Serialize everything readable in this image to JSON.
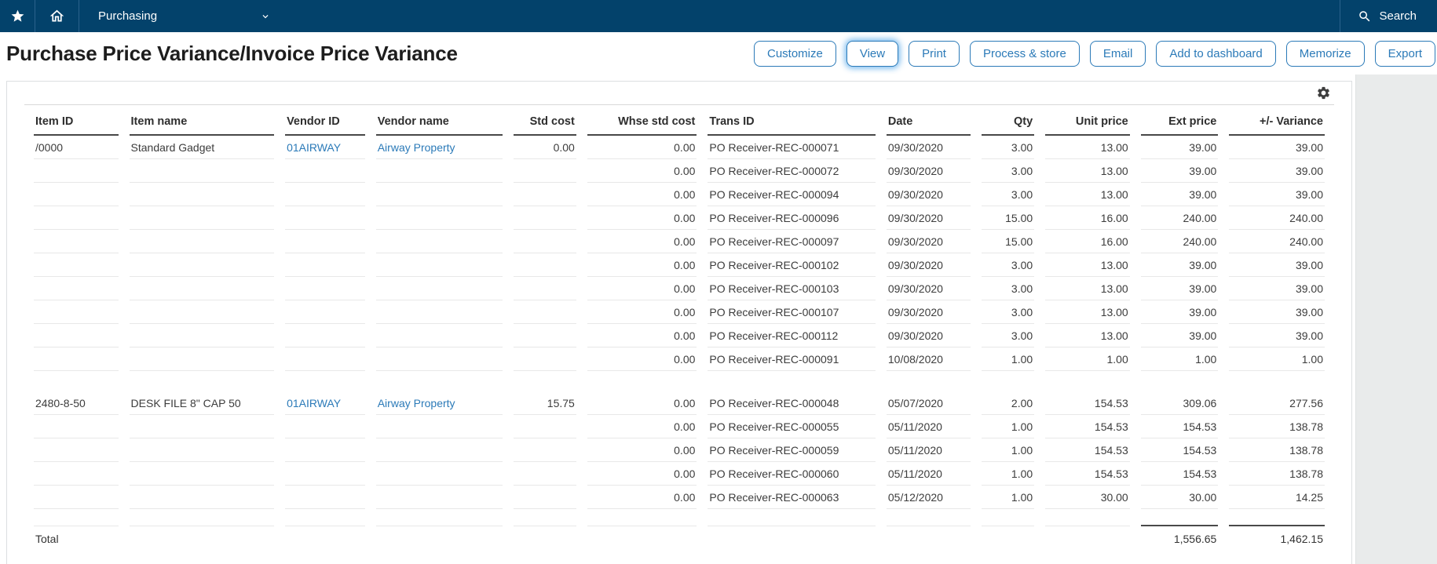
{
  "nav": {
    "menu_label": "Purchasing",
    "search_label": "Search",
    "icons": [
      "star-icon",
      "home-icon",
      "chevron-down-icon",
      "magnifier-icon"
    ]
  },
  "page": {
    "title": "Purchase Price Variance/Invoice Price Variance"
  },
  "toolbar": {
    "buttons": [
      {
        "label": "Customize"
      },
      {
        "label": "View",
        "focused": true
      },
      {
        "label": "Print"
      },
      {
        "label": "Process & store"
      },
      {
        "label": "Email"
      },
      {
        "label": "Add to dashboard"
      },
      {
        "label": "Memorize"
      },
      {
        "label": "Export"
      }
    ]
  },
  "card": {
    "settings_icon": "gear-icon"
  },
  "report": {
    "columns": [
      {
        "label": "Item ID",
        "align": "left"
      },
      {
        "label": "Item name",
        "align": "left"
      },
      {
        "label": "Vendor ID",
        "align": "left"
      },
      {
        "label": "Vendor name",
        "align": "left"
      },
      {
        "label": "Std cost",
        "align": "right"
      },
      {
        "label": "Whse std cost",
        "align": "right"
      },
      {
        "label": "Trans ID",
        "align": "left"
      },
      {
        "label": "Date",
        "align": "left"
      },
      {
        "label": "Qty",
        "align": "right"
      },
      {
        "label": "Unit price",
        "align": "right"
      },
      {
        "label": "Ext price",
        "align": "right"
      },
      {
        "label": "+/- Variance",
        "align": "right"
      }
    ],
    "groups": [
      {
        "item_id": "/0000",
        "item_name": "Standard Gadget",
        "vendor_id": "01AIRWAY",
        "vendor_name": "Airway Property",
        "std_cost": "0.00",
        "rows": [
          {
            "whse_std_cost": "0.00",
            "trans_id": "PO Receiver-REC-000071",
            "date": "09/30/2020",
            "qty": "3.00",
            "unit_price": "13.00",
            "ext_price": "39.00",
            "variance": "39.00"
          },
          {
            "whse_std_cost": "0.00",
            "trans_id": "PO Receiver-REC-000072",
            "date": "09/30/2020",
            "qty": "3.00",
            "unit_price": "13.00",
            "ext_price": "39.00",
            "variance": "39.00"
          },
          {
            "whse_std_cost": "0.00",
            "trans_id": "PO Receiver-REC-000094",
            "date": "09/30/2020",
            "qty": "3.00",
            "unit_price": "13.00",
            "ext_price": "39.00",
            "variance": "39.00"
          },
          {
            "whse_std_cost": "0.00",
            "trans_id": "PO Receiver-REC-000096",
            "date": "09/30/2020",
            "qty": "15.00",
            "unit_price": "16.00",
            "ext_price": "240.00",
            "variance": "240.00"
          },
          {
            "whse_std_cost": "0.00",
            "trans_id": "PO Receiver-REC-000097",
            "date": "09/30/2020",
            "qty": "15.00",
            "unit_price": "16.00",
            "ext_price": "240.00",
            "variance": "240.00"
          },
          {
            "whse_std_cost": "0.00",
            "trans_id": "PO Receiver-REC-000102",
            "date": "09/30/2020",
            "qty": "3.00",
            "unit_price": "13.00",
            "ext_price": "39.00",
            "variance": "39.00"
          },
          {
            "whse_std_cost": "0.00",
            "trans_id": "PO Receiver-REC-000103",
            "date": "09/30/2020",
            "qty": "3.00",
            "unit_price": "13.00",
            "ext_price": "39.00",
            "variance": "39.00"
          },
          {
            "whse_std_cost": "0.00",
            "trans_id": "PO Receiver-REC-000107",
            "date": "09/30/2020",
            "qty": "3.00",
            "unit_price": "13.00",
            "ext_price": "39.00",
            "variance": "39.00"
          },
          {
            "whse_std_cost": "0.00",
            "trans_id": "PO Receiver-REC-000112",
            "date": "09/30/2020",
            "qty": "3.00",
            "unit_price": "13.00",
            "ext_price": "39.00",
            "variance": "39.00"
          },
          {
            "whse_std_cost": "0.00",
            "trans_id": "PO Receiver-REC-000091",
            "date": "10/08/2020",
            "qty": "1.00",
            "unit_price": "1.00",
            "ext_price": "1.00",
            "variance": "1.00"
          }
        ]
      },
      {
        "item_id": "2480-8-50",
        "item_name": "DESK FILE 8\" CAP 50",
        "vendor_id": "01AIRWAY",
        "vendor_name": "Airway Property",
        "std_cost": "15.75",
        "rows": [
          {
            "whse_std_cost": "0.00",
            "trans_id": "PO Receiver-REC-000048",
            "date": "05/07/2020",
            "qty": "2.00",
            "unit_price": "154.53",
            "ext_price": "309.06",
            "variance": "277.56"
          },
          {
            "whse_std_cost": "0.00",
            "trans_id": "PO Receiver-REC-000055",
            "date": "05/11/2020",
            "qty": "1.00",
            "unit_price": "154.53",
            "ext_price": "154.53",
            "variance": "138.78"
          },
          {
            "whse_std_cost": "0.00",
            "trans_id": "PO Receiver-REC-000059",
            "date": "05/11/2020",
            "qty": "1.00",
            "unit_price": "154.53",
            "ext_price": "154.53",
            "variance": "138.78"
          },
          {
            "whse_std_cost": "0.00",
            "trans_id": "PO Receiver-REC-000060",
            "date": "05/11/2020",
            "qty": "1.00",
            "unit_price": "154.53",
            "ext_price": "154.53",
            "variance": "138.78"
          },
          {
            "whse_std_cost": "0.00",
            "trans_id": "PO Receiver-REC-000063",
            "date": "05/12/2020",
            "qty": "1.00",
            "unit_price": "30.00",
            "ext_price": "30.00",
            "variance": "14.25"
          }
        ]
      }
    ],
    "total": {
      "label": "Total",
      "ext_price": "1,556.65",
      "variance": "1,462.15"
    }
  },
  "colors": {
    "nav_bg": "#03426b",
    "accent_blue": "#2b7ab8",
    "page_gray": "#e9ebeb",
    "header_rule": "#474747",
    "row_rule": "#e8e8e8"
  }
}
